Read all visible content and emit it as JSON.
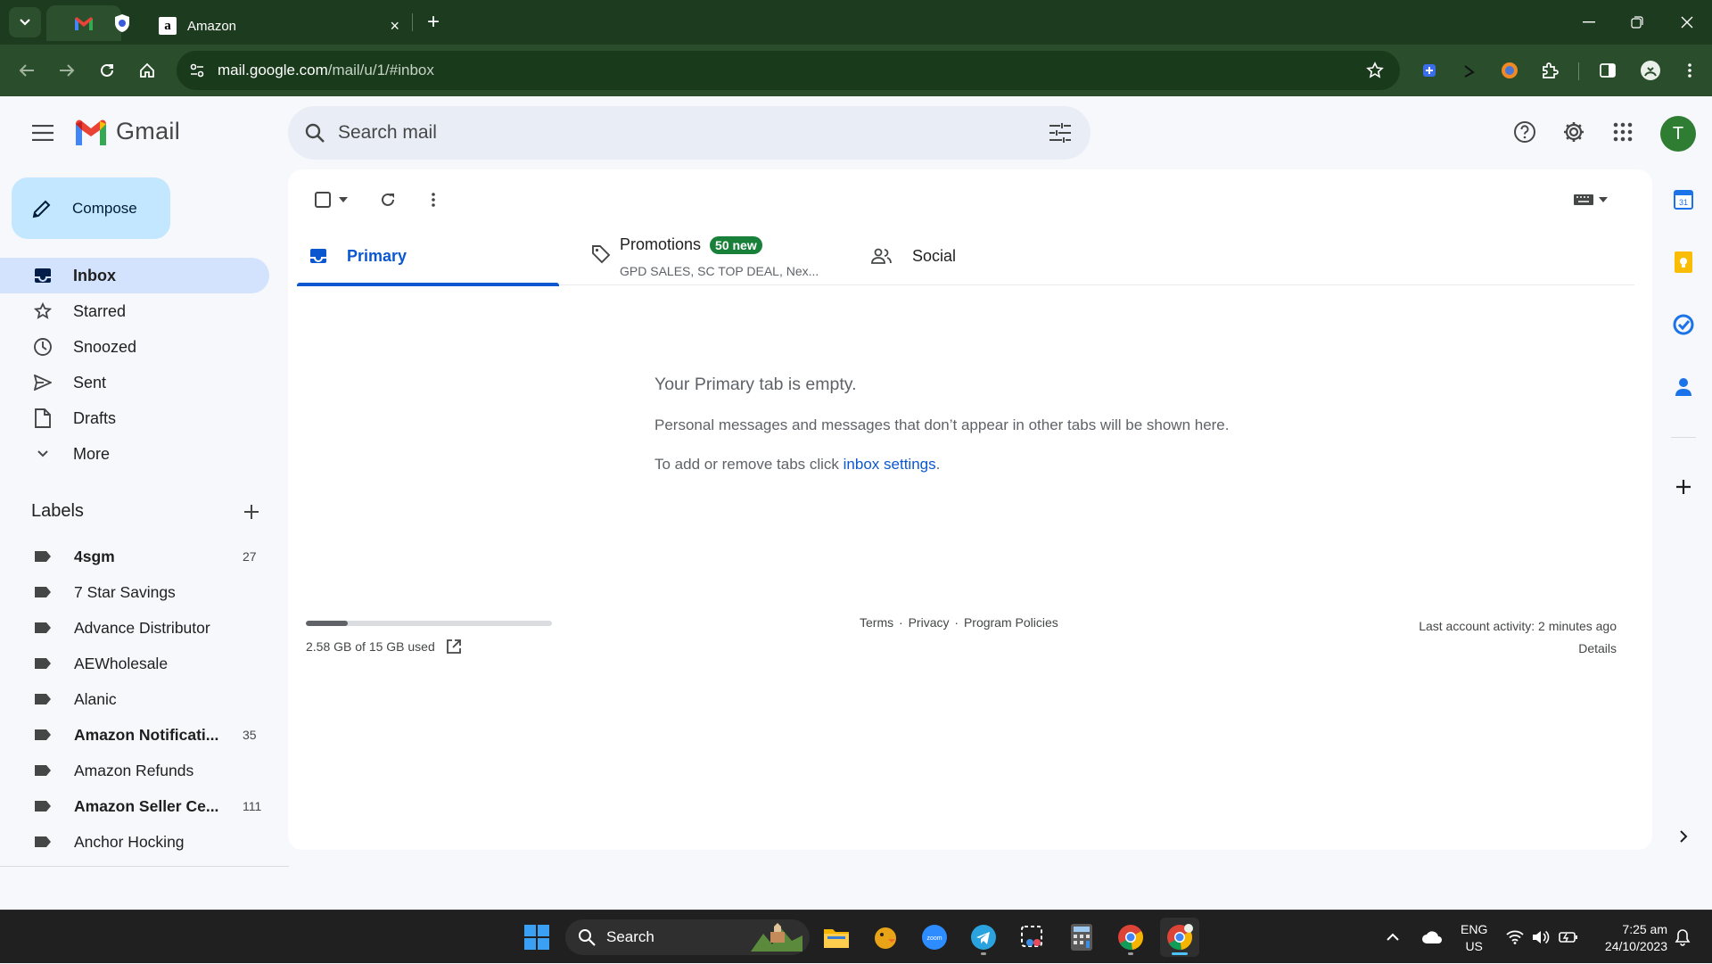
{
  "browser": {
    "tab_title": "Amazon",
    "tab_close": "×",
    "new_tab": "+",
    "url_host": "mail.google.com",
    "url_path": "/mail/u/1/#inbox"
  },
  "gmail": {
    "brand": "Gmail",
    "search_placeholder": "Search mail",
    "avatar_letter": "T",
    "compose_label": "Compose",
    "nav": [
      {
        "label": "Inbox",
        "icon": "inbox-icon"
      },
      {
        "label": "Starred",
        "icon": "star-icon"
      },
      {
        "label": "Snoozed",
        "icon": "clock-icon"
      },
      {
        "label": "Sent",
        "icon": "send-icon"
      },
      {
        "label": "Drafts",
        "icon": "draft-icon"
      },
      {
        "label": "More",
        "icon": "chevron-down-icon"
      }
    ],
    "labels_title": "Labels",
    "labels": [
      {
        "name": "4sgm",
        "count": "27",
        "bold": true
      },
      {
        "name": "7 Star Savings",
        "count": "",
        "bold": false
      },
      {
        "name": "Advance Distributor",
        "count": "",
        "bold": false
      },
      {
        "name": "AEWholesale",
        "count": "",
        "bold": false
      },
      {
        "name": "Alanic",
        "count": "",
        "bold": false
      },
      {
        "name": "Amazon Notificati...",
        "count": "35",
        "bold": true
      },
      {
        "name": "Amazon Refunds",
        "count": "",
        "bold": false
      },
      {
        "name": "Amazon Seller Ce...",
        "count": "111",
        "bold": true
      },
      {
        "name": "Anchor Hocking",
        "count": "",
        "bold": false
      }
    ],
    "tabs": {
      "primary": "Primary",
      "promotions": "Promotions",
      "promotions_badge": "50 new",
      "promotions_sub": "GPD SALES, SC TOP DEAL, Nex...",
      "social": "Social"
    },
    "empty": {
      "heading": "Your Primary tab is empty.",
      "line1": "Personal messages and messages that don’t appear in other tabs will be shown here.",
      "line2_prefix": "To add or remove tabs click ",
      "line2_link": "inbox settings",
      "line2_suffix": "."
    },
    "storage": {
      "text": "2.58 GB of 15 GB used",
      "fraction": 0.172
    },
    "footer": {
      "terms": "Terms",
      "sep": "·",
      "privacy": "Privacy",
      "policies": "Program Policies",
      "activity": "Last account activity: 2 minutes ago",
      "details": "Details"
    }
  },
  "taskbar": {
    "search": "Search",
    "lang1": "ENG",
    "lang2": "US",
    "time": "7:25 am",
    "date": "24/10/2023"
  },
  "colors": {
    "chrome_frame": "#1d3b1f",
    "chrome_toolbar": "#2a4d2b",
    "gmail_accent": "#0b57d0",
    "compose_bg": "#c2e7ff",
    "promotions_badge": "#188038"
  }
}
